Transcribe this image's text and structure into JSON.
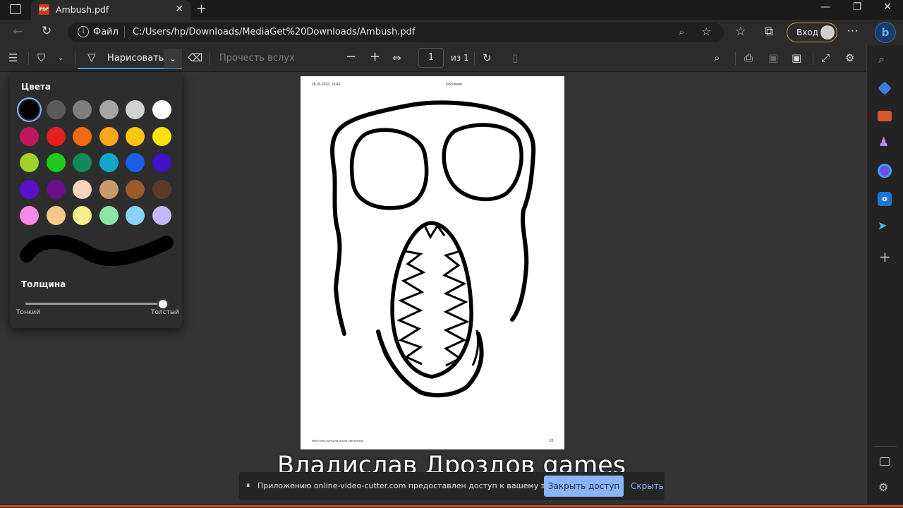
{
  "tab": {
    "title": "Ambush.pdf",
    "badge": "PDF"
  },
  "address": {
    "scheme_label": "Файл",
    "url": "C:/Users/hp/Downloads/MediaGet%20Downloads/Ambush.pdf",
    "login_label": "Вход"
  },
  "toolbar": {
    "draw_label": "Нарисовать",
    "read_aloud": "Прочесть вслух",
    "page_number": "1",
    "page_of": "из 1"
  },
  "draw_panel": {
    "colors_title": "Цвета",
    "thickness_title": "Толщина",
    "thin_label": "Тонкий",
    "thick_label": "Толстый",
    "thickness_level": 1.0,
    "colors": [
      "#000000",
      "#5a5a5a",
      "#7e7e7e",
      "#a6a6a6",
      "#d2d2d2",
      "#ffffff",
      "#c2185b",
      "#e61e1e",
      "#f36a12",
      "#f9a51a",
      "#f9c50f",
      "#fbe10f",
      "#9fd12a",
      "#1ec81e",
      "#0f8a5a",
      "#12a7c8",
      "#1a5fe6",
      "#3d12c8",
      "#5a0fc8",
      "#6a0f8a",
      "#f5d3c0",
      "#c89a6a",
      "#9a5a2a",
      "#5a3a2a",
      "#f58ae6",
      "#f5c88a",
      "#f5f08a",
      "#8ae6a6",
      "#8ad2f5",
      "#c3b8f5"
    ],
    "selected_color": "#000000"
  },
  "pdf": {
    "header_left": "28.03.2023, 15:42",
    "header_center": "Document",
    "footer_left": "https://chto-narisovat-risovat-vse-ambush",
    "footer_right": "1/1"
  },
  "watermark": "Владислав Дроздов games",
  "share": {
    "message": "Приложению online-video-cutter.com предоставлен доступ к вашему экрану.",
    "stop_label": "Закрыть доступ",
    "hide_label": "Скрыть"
  },
  "icons": {
    "sidebar": [
      "search-icon",
      "shopping-tag-icon",
      "toolbox-icon",
      "chess-icon",
      "copilot-icon",
      "outlook-icon",
      "telegram-icon",
      "plus-icon"
    ],
    "accent": "#5aa0e6"
  }
}
